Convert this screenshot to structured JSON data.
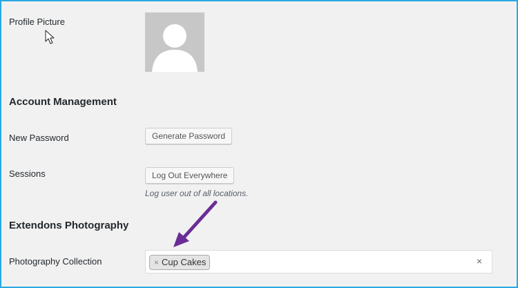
{
  "profile": {
    "picture_label": "Profile Picture"
  },
  "account_management": {
    "heading": "Account Management",
    "new_password_label": "New Password",
    "generate_password_button": "Generate Password",
    "sessions_label": "Sessions",
    "log_out_everywhere_button": "Log Out Everywhere",
    "sessions_hint": "Log user out of all locations."
  },
  "extendons_photography": {
    "heading": "Extendons Photography",
    "collection_label": "Photography Collection",
    "selected_items": [
      {
        "label": "Cup Cakes",
        "remove_symbol": "×"
      }
    ],
    "clear_symbol": "×"
  },
  "icons": {
    "avatar": "default-avatar-silhouette",
    "cursor": "mouse-pointer-icon",
    "annotation": "purple-arrow-icon"
  },
  "colors": {
    "frame_border": "#29a9e1",
    "page_background": "#f1f1f1",
    "annotation_arrow": "#6b2d96",
    "avatar_background": "#c7c7c7"
  }
}
